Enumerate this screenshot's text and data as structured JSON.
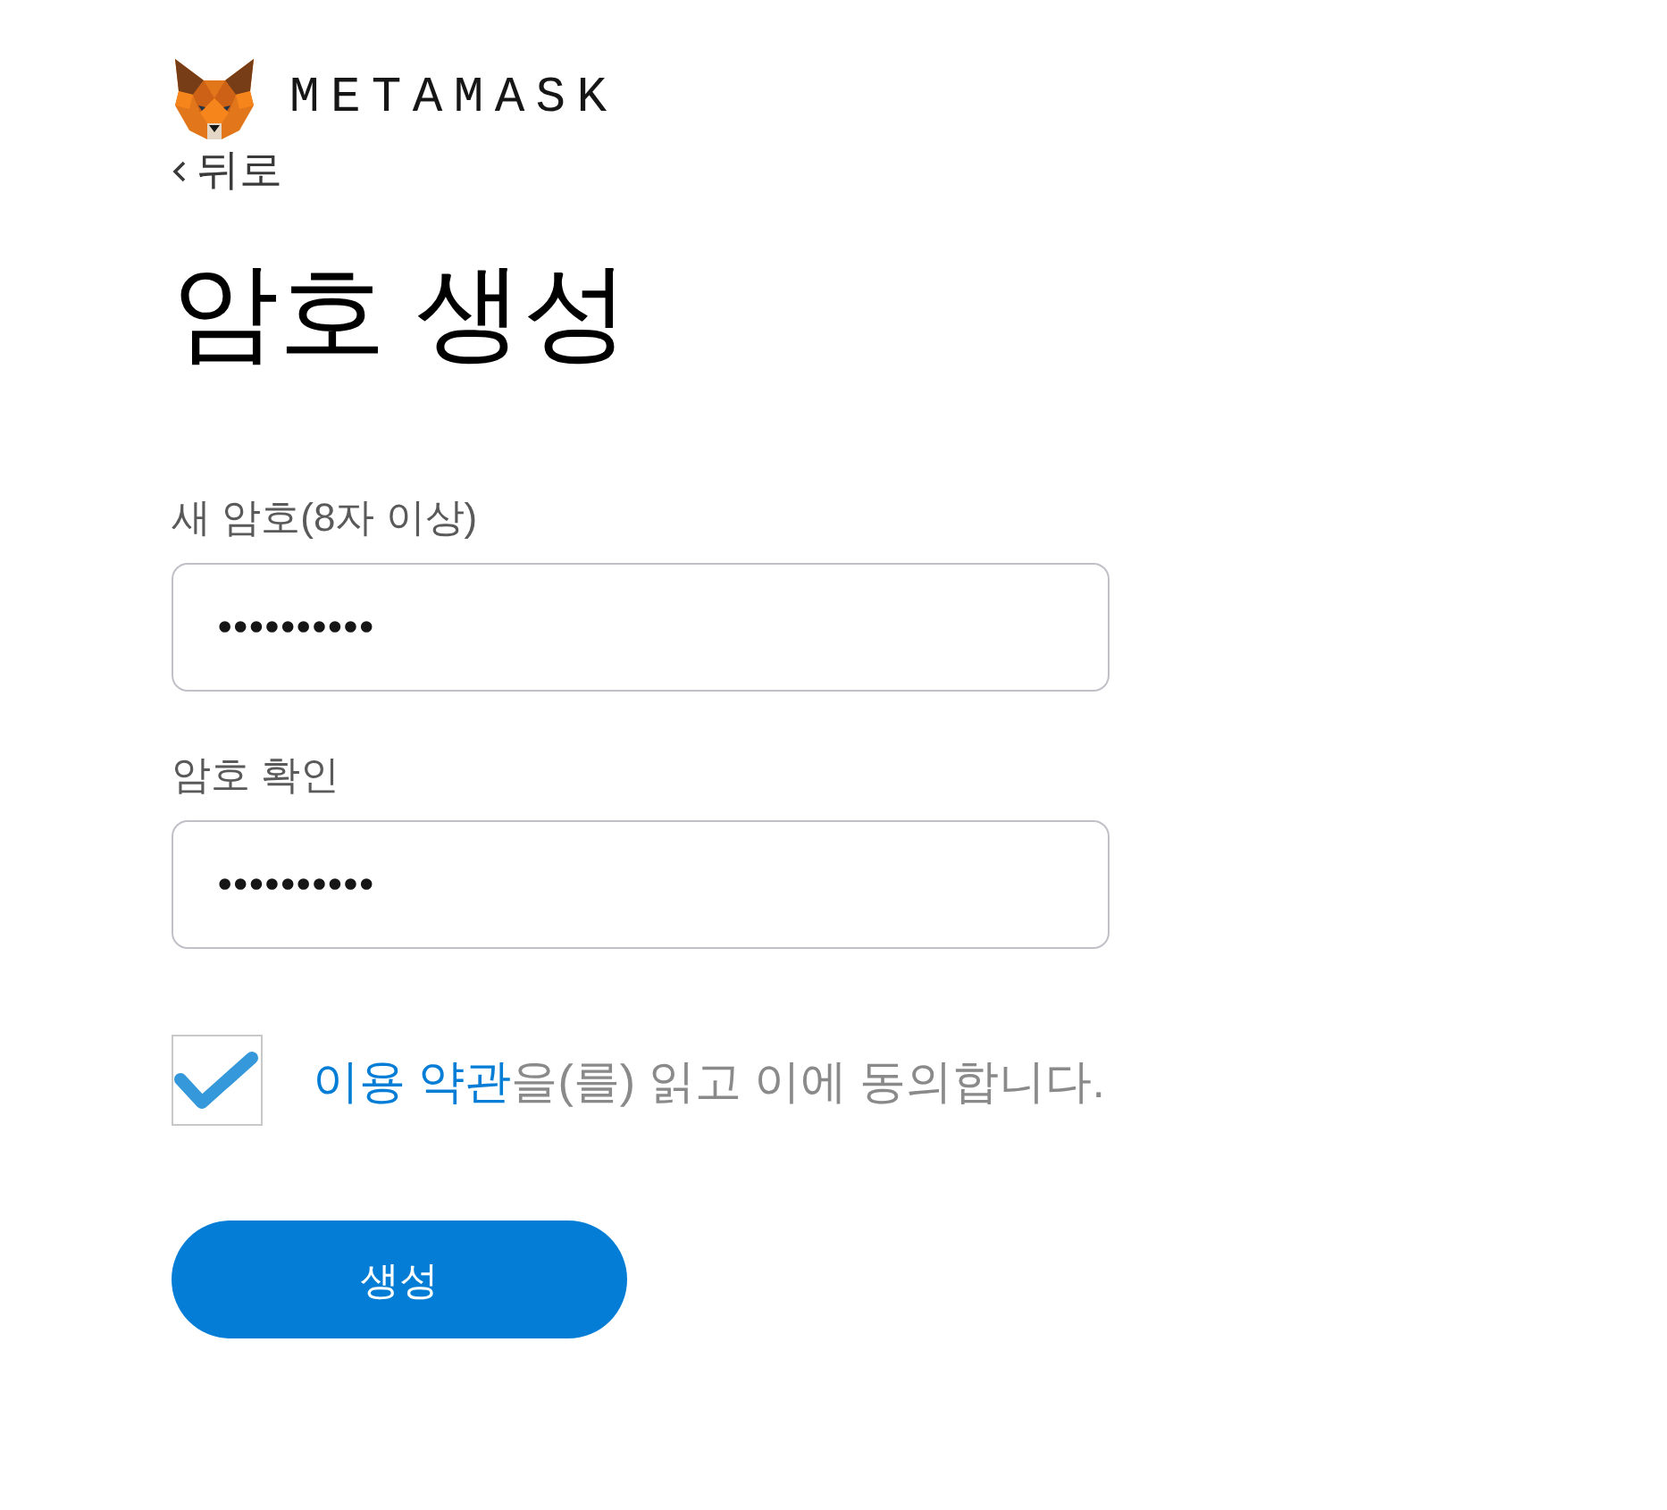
{
  "logo": {
    "wordmark": "METAMASK"
  },
  "back_link": {
    "label": "뒤로"
  },
  "title": "암호 생성",
  "fields": [
    {
      "label": "새 암호(8자 이상)",
      "value": "••••••••••"
    },
    {
      "label": "암호 확인",
      "value": "••••••••••"
    }
  ],
  "terms": {
    "checked": true,
    "link": "이용 약관",
    "text": "을(를) 읽고 이에 동의합니다."
  },
  "submit_button": {
    "label": "생성"
  }
}
